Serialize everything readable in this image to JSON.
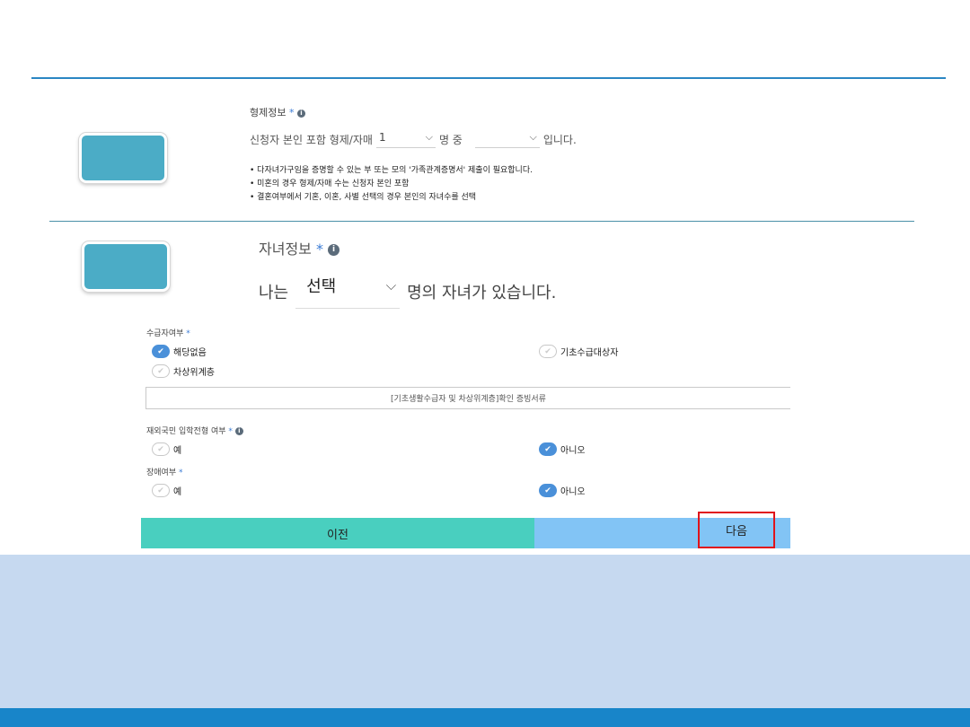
{
  "siblings": {
    "title": "형제정보",
    "required_mark": "*",
    "prefix": "신청자 본인 포함 형제/자매",
    "count_value": "1",
    "mid": "명 중",
    "married_value": "",
    "suffix": "입니다.",
    "notes": [
      "다자녀가구임을 증명할 수 있는 부 또는 모의 '가족관계증명서' 제출이 필요합니다.",
      "미혼의 경우 형제/자매 수는 신청자 본인 포함",
      "결혼여부에서 기혼, 이혼, 사별 선택의 경우 본인의 자녀수를 선택"
    ]
  },
  "children": {
    "title": "자녀정보",
    "required_mark": "*",
    "prefix": "나는",
    "select_value": "선택",
    "suffix": "명의 자녀가 있습니다."
  },
  "welfare": {
    "label": "수급자여부",
    "required_mark": "*",
    "options": [
      {
        "label": "해당없음",
        "selected": true
      },
      {
        "label": "기초수급대상자",
        "selected": false
      },
      {
        "label": "차상위계층",
        "selected": false
      }
    ],
    "doc_label": "[기초생활수급자 및 차상위계층]확인 증빙서류"
  },
  "overseas": {
    "label": "재외국민 입학전형 여부",
    "required_mark": "*",
    "yes": "예",
    "no": "아니오",
    "selected": "no"
  },
  "disability": {
    "label": "장애여부",
    "required_mark": "*",
    "yes": "예",
    "no": "아니오",
    "selected": "no"
  },
  "buttons": {
    "prev": "이전",
    "next": "다음"
  },
  "icons": {
    "info": "info-icon",
    "chevron": "chevron-down-icon",
    "check": "check-icon"
  },
  "colors": {
    "accent_blue": "#2a86c3",
    "step_badge": "#4bacc6",
    "prev_button": "#49cfbf",
    "next_button": "#82c4f5",
    "highlight_border": "#e0131a",
    "bottom_panel": "#c6d9f0",
    "bottom_bar": "#1885c9"
  }
}
